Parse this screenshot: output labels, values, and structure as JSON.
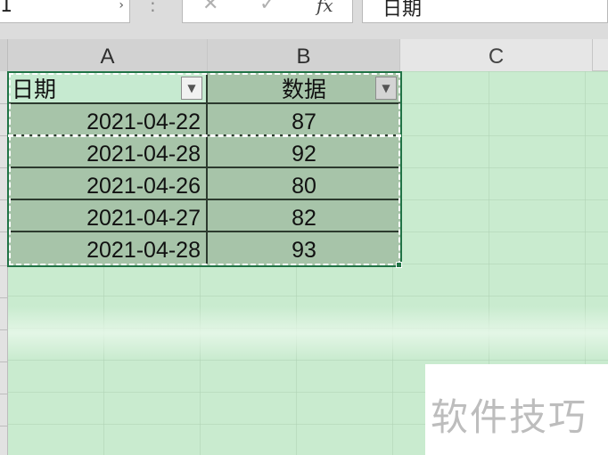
{
  "formula_bar": {
    "name_box_value": "1",
    "name_box_arrow": "›",
    "separator": ":",
    "cancel_glyph": "✕",
    "enter_glyph": "✓",
    "fx_glyph": "fx",
    "formula_value": "日期"
  },
  "columns": [
    "A",
    "B",
    "C"
  ],
  "table": {
    "headers": [
      "日期",
      "数据"
    ],
    "filter_icons": [
      "dropdown-arrow-icon",
      "filter-active-icon"
    ],
    "rows": [
      {
        "date": "2021-04-22",
        "value": "87"
      },
      {
        "date": "2021-04-28",
        "value": "92"
      },
      {
        "date": "2021-04-26",
        "value": "80"
      },
      {
        "date": "2021-04-27",
        "value": "82"
      },
      {
        "date": "2021-04-28",
        "value": "93"
      }
    ]
  },
  "watermark": "软件技巧",
  "colors": {
    "sheet_background": "#c9ebcf",
    "selection_fill": "#a7c4a9",
    "selection_border": "#217346"
  }
}
